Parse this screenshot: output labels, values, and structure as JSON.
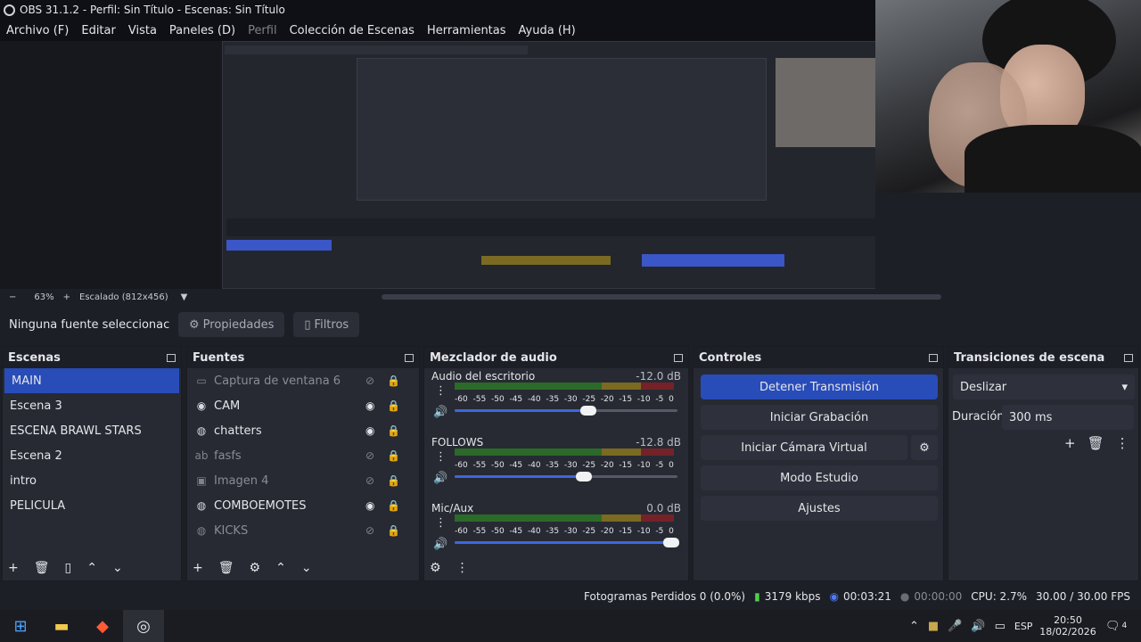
{
  "window": {
    "title": "OBS 31.1.2 - Perfil: Sin Título - Escenas: Sin Título"
  },
  "menu": [
    "Archivo (F)",
    "Editar",
    "Vista",
    "Paneles (D)",
    "Perfil",
    "Colección de Escenas",
    "Herramientas",
    "Ayuda (H)"
  ],
  "zoom": {
    "percent": "63%",
    "scale_label": "Escalado (812x456)"
  },
  "source_bar": {
    "no_source": "Ninguna fuente seleccionac",
    "properties": "Propiedades",
    "filters": "Filtros"
  },
  "scenes": {
    "title": "Escenas",
    "items": [
      "MAIN",
      "Escena 3",
      "ESCENA BRAWL STARS",
      "Escena 2",
      "intro",
      "PELICULA"
    ]
  },
  "sources": {
    "title": "Fuentes",
    "items": [
      {
        "label": "Captura de ventana 6",
        "icon": "window-icon",
        "visible": false
      },
      {
        "label": "CAM",
        "icon": "camera-icon",
        "visible": true
      },
      {
        "label": "chatters",
        "icon": "browser-icon",
        "visible": true
      },
      {
        "label": "fasfs",
        "icon": "text-icon",
        "visible": false
      },
      {
        "label": "Imagen 4",
        "icon": "image-icon",
        "visible": false
      },
      {
        "label": "COMBOEMOTES",
        "icon": "browser-icon",
        "visible": true
      },
      {
        "label": "KICKS",
        "icon": "browser-icon",
        "visible": false
      }
    ]
  },
  "mixer": {
    "title": "Mezclador de audio",
    "ticks": [
      "-60",
      "-55",
      "-50",
      "-45",
      "-40",
      "-35",
      "-30",
      "-25",
      "-20",
      "-15",
      "-10",
      "-5",
      "0"
    ],
    "channels": [
      {
        "name": "Audio del escritorio",
        "db": "-12.0 dB",
        "volume": 0.6
      },
      {
        "name": "FOLLOWS",
        "db": "-12.8 dB",
        "volume": 0.58
      },
      {
        "name": "Mic/Aux",
        "db": "0.0 dB",
        "volume": 0.97
      }
    ]
  },
  "controls": {
    "title": "Controles",
    "stop_stream": "Detener Transmisión",
    "start_recording": "Iniciar Grabación",
    "virtual_cam": "Iniciar Cámara Virtual",
    "studio_mode": "Modo Estudio",
    "settings": "Ajustes"
  },
  "transitions": {
    "title": "Transiciones de escena",
    "selected": "Deslizar",
    "duration_label": "Duración",
    "duration": "300 ms"
  },
  "status": {
    "dropped": "Fotogramas Perdidos 0 (0.0%)",
    "bitrate": "3179 kbps",
    "stream_time": "00:03:21",
    "rec_time": "00:00:00",
    "cpu": "CPU: 2.7%",
    "fps": "30.00 / 30.00 FPS"
  },
  "taskbar": {
    "lang": "ESP",
    "time": "20:50",
    "date": "18/02/2026",
    "notif": "4"
  },
  "colors": {
    "accent": "#284cb8",
    "panel": "#272a33",
    "bg": "#1d1f26"
  }
}
